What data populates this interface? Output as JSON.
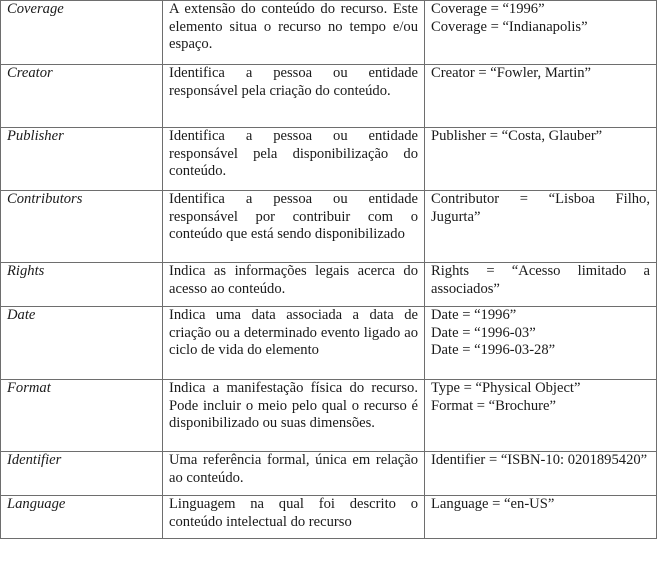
{
  "table": {
    "rows": [
      {
        "element": "Coverage",
        "description": "A extensão do conteúdo do recurso. Este elemento situa o recurso no tempo e/ou espaço.",
        "examples": [
          "Coverage = “1996”",
          "Coverage = “Indianapolis”"
        ]
      },
      {
        "element": "Creator",
        "description": "Identifica a pessoa ou entidade responsável pela criação do conteúdo.",
        "examples": [
          "Creator = “Fowler, Martin”"
        ]
      },
      {
        "element": "Publisher",
        "description": "Identifica a pessoa ou entidade responsável pela disponibilização do conteúdo.",
        "examples": [
          "Publisher = “Costa, Glauber”"
        ]
      },
      {
        "element": "Contributors",
        "description": "Identifica a pessoa ou entidade responsável por contribuir com o conteúdo que está sendo disponibilizado",
        "examples": [
          "Contributor = “Lisboa Filho, Jugurta”"
        ]
      },
      {
        "element": "Rights",
        "description": "Indica as informações legais acerca do acesso ao conteúdo.",
        "examples": [
          "Rights = “Acesso limitado a associados”"
        ]
      },
      {
        "element": "Date",
        "description": "Indica uma data associada a data de criação ou a determinado evento ligado ao ciclo de vida do elemento",
        "examples": [
          "Date = “1996”",
          "Date = “1996-03”",
          "Date = “1996-03-28”"
        ]
      },
      {
        "element": "Format",
        "description": "Indica a manifestação física do recurso. Pode incluir o meio pelo qual o recurso é disponibilizado ou suas dimensões.",
        "examples": [
          "Type = “Physical Object”",
          "Format = “Brochure”"
        ]
      },
      {
        "element": "Identifier",
        "description": "Uma referência formal, única em relação ao conteúdo.",
        "examples": [
          "Identifier = “ISBN-10: 0201895420”"
        ]
      },
      {
        "element": "Language",
        "description": "Linguagem na qual foi descrito o conteúdo intelectual do recurso",
        "examples": [
          "Language = “en-US”"
        ]
      }
    ]
  }
}
